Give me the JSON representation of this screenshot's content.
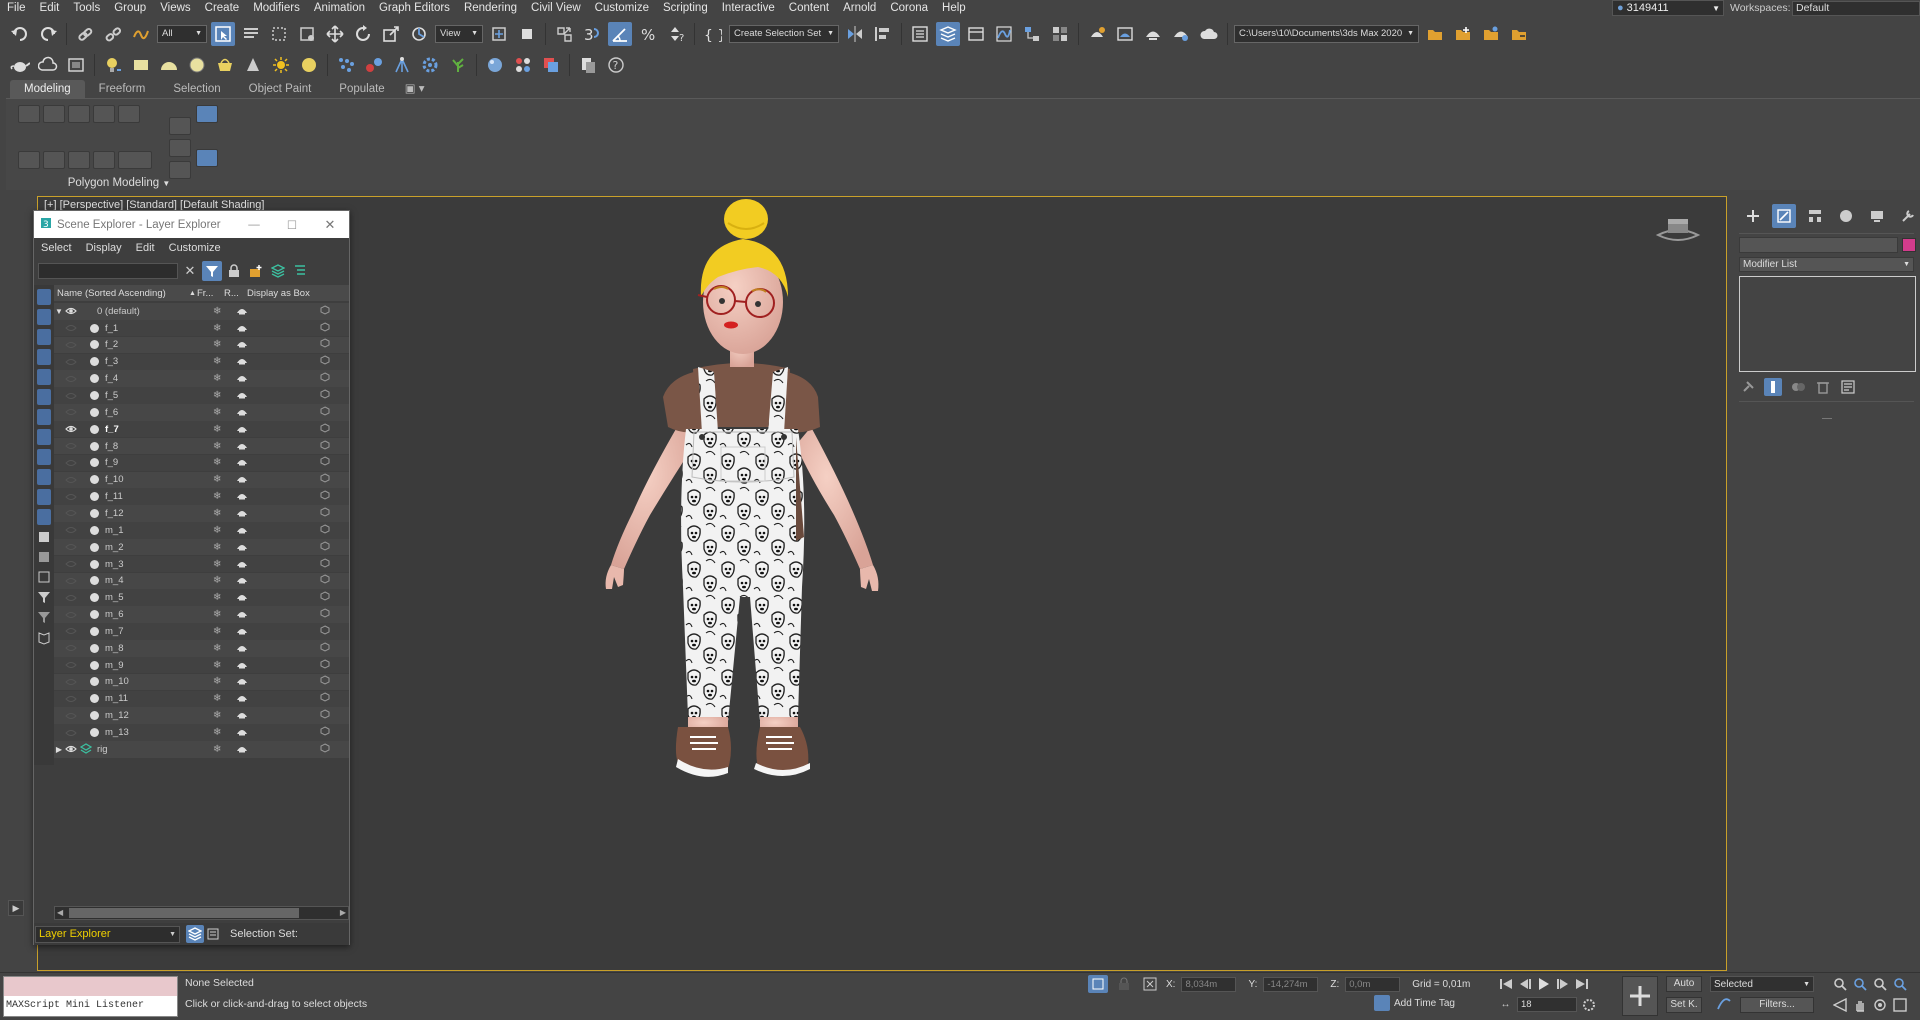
{
  "menubar": {
    "items": [
      "File",
      "Edit",
      "Tools",
      "Group",
      "Views",
      "Create",
      "Modifiers",
      "Animation",
      "Graph Editors",
      "Rendering",
      "Civil View",
      "Customize",
      "Scripting",
      "Interactive",
      "Content",
      "Arnold",
      "Corona",
      "Help"
    ],
    "user": "3149411",
    "workspaces_label": "Workspaces:",
    "workspace_value": "Default"
  },
  "toolbar": {
    "filter_value": "All",
    "ref_coord_value": "View",
    "selection_set_label": "Create Selection Set",
    "project_path": "C:\\Users\\10\\Documents\\3ds Max 2020"
  },
  "ribbon": {
    "tabs": [
      "Modeling",
      "Freeform",
      "Selection",
      "Object Paint",
      "Populate"
    ],
    "panel_label": "Polygon Modeling"
  },
  "viewport": {
    "label": "[+] [Perspective] [Standard] [Default Shading]",
    "border_color": "#c8a02a"
  },
  "scene_explorer": {
    "title": "Scene Explorer - Layer Explorer",
    "menu": [
      "Select",
      "Display",
      "Edit",
      "Customize"
    ],
    "columns": {
      "name": "Name (Sorted Ascending)",
      "frozen": "Fr...",
      "render": "R...",
      "box": "Display as Box"
    },
    "rows": [
      {
        "name": "0 (default)",
        "level": 0,
        "expanded": true,
        "eye": true,
        "type": "layer"
      },
      {
        "name": "f_1",
        "level": 1
      },
      {
        "name": "f_2",
        "level": 1
      },
      {
        "name": "f_3",
        "level": 1
      },
      {
        "name": "f_4",
        "level": 1
      },
      {
        "name": "f_5",
        "level": 1
      },
      {
        "name": "f_6",
        "level": 1
      },
      {
        "name": "f_7",
        "level": 1,
        "eye": true,
        "selected": true
      },
      {
        "name": "f_8",
        "level": 1
      },
      {
        "name": "f_9",
        "level": 1
      },
      {
        "name": "f_10",
        "level": 1
      },
      {
        "name": "f_11",
        "level": 1
      },
      {
        "name": "f_12",
        "level": 1
      },
      {
        "name": "m_1",
        "level": 1
      },
      {
        "name": "m_2",
        "level": 1
      },
      {
        "name": "m_3",
        "level": 1
      },
      {
        "name": "m_4",
        "level": 1
      },
      {
        "name": "m_5",
        "level": 1
      },
      {
        "name": "m_6",
        "level": 1
      },
      {
        "name": "m_7",
        "level": 1
      },
      {
        "name": "m_8",
        "level": 1
      },
      {
        "name": "m_9",
        "level": 1
      },
      {
        "name": "m_10",
        "level": 1
      },
      {
        "name": "m_11",
        "level": 1
      },
      {
        "name": "m_12",
        "level": 1
      },
      {
        "name": "m_13",
        "level": 1
      },
      {
        "name": "rig",
        "level": 0,
        "expanded": false,
        "eye": true,
        "type": "layer"
      }
    ],
    "bottom_explorer_value": "Layer Explorer",
    "selection_set_label": "Selection Set:"
  },
  "command_panel": {
    "modifier_list_label": "Modifier List",
    "color_swatch": "#d33c8c"
  },
  "status": {
    "maxscript_label": "MAXScript Mini Listener",
    "selection_status": "None Selected",
    "prompt": "Click or click-and-drag to select objects",
    "x_label": "X:",
    "x_value": "8,034m",
    "y_label": "Y:",
    "y_value": "-14,274m",
    "z_label": "Z:",
    "z_value": "0,0m",
    "grid": "Grid = 0,01m",
    "add_time_tag": "Add Time Tag",
    "auto_label": "Auto",
    "set_key_label": "Set K.",
    "selected_dropdown": "Selected",
    "filters_label": "Filters...",
    "frame_value": "18"
  }
}
